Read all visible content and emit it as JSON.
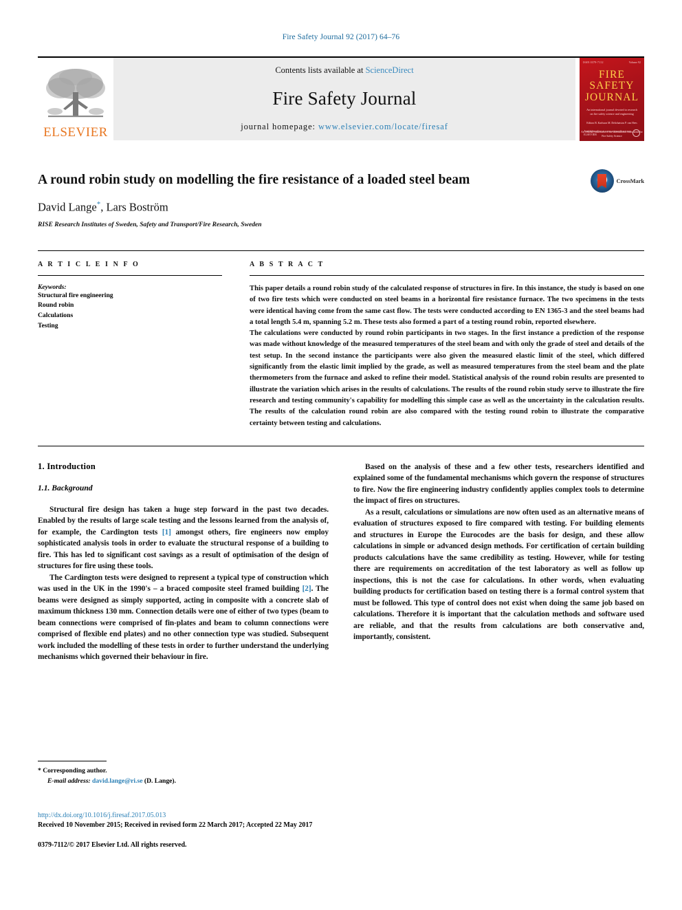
{
  "running_head": "Fire Safety Journal 92 (2017) 64–76",
  "header": {
    "publisher_name": "ELSEVIER",
    "publisher_logo_icon": "elsevier-tree-icon",
    "contents_prefix": "Contents lists available at",
    "contents_link": "ScienceDirect",
    "journal_title": "Fire Safety Journal",
    "homepage_prefix": "journal homepage:",
    "homepage_url": "www.elsevier.com/locate/firesaf",
    "cover": {
      "line1": "FIRE",
      "line2": "SAFETY",
      "line3": "JOURNAL",
      "subtitle": "An international journal devoted to research on fire safety science and engineering",
      "editors": "Editors B. Karlsson M. Delichatsios P. van Hees",
      "assoc": "An Official Publication of the International Association for Fire Safety Science",
      "top_left": "ISSN 0379-7112",
      "top_right": "Volume 92",
      "bottom_left": "Available online at www.sciencedirect.com ELSEVIER",
      "seal_icon": "iafss-seal-icon"
    },
    "colors": {
      "link": "#2a7fb5",
      "band_bg": "#ececec",
      "elsevier_orange": "#e87722",
      "cover_red": "#c5151b"
    }
  },
  "article": {
    "title": "A round robin study on modelling the fire resistance of a loaded steel beam",
    "authors": "David Lange",
    "author_marker": "*",
    "authors_rest": ", Lars Boström",
    "affiliation": "RISE Research Institutes of Sweden, Safety and Transport/Fire Research, Sweden",
    "crossmark_label": "CrossMark"
  },
  "article_info": {
    "heading": "A R T I C L E   I N F O",
    "keywords_label": "Keywords:",
    "keywords": [
      "Structural fire engineering",
      "Round robin",
      "Calculations",
      "Testing"
    ]
  },
  "abstract": {
    "heading": "A B S T R A C T",
    "paragraphs": [
      "This paper details a round robin study of the calculated response of structures in fire. In this instance, the study is based on one of two fire tests which were conducted on steel beams in a horizontal fire resistance furnace. The two specimens in the tests were identical having come from the same cast flow. The tests were conducted according to EN 1365-3 and the steel beams had a total length 5.4 m, spanning 5.2 m. These tests also formed a part of a testing round robin, reported elsewhere.",
      "The calculations were conducted by round robin participants in two stages. In the first instance a prediction of the response was made without knowledge of the measured temperatures of the steel beam and with only the grade of steel and details of the test setup. In the second instance the participants were also given the measured elastic limit of the steel, which differed significantly from the elastic limit implied by the grade, as well as measured temperatures from the steel beam and the plate thermometers from the furnace and asked to refine their model. Statistical analysis of the round robin results are presented to illustrate the variation which arises in the results of calculations. The results of the round robin study serve to illustrate the fire research and testing community's capability for modelling this simple case as well as the uncertainty in the calculation results. The results of the calculation round robin are also compared with the testing round robin to illustrate the comparative certainty between testing and calculations."
    ]
  },
  "body": {
    "section_number_title": "1.  Introduction",
    "subsection_number_title": "1.1.  Background",
    "left_paragraphs": [
      "Structural fire design has taken a huge step forward in the past two decades. Enabled by the results of large scale testing and the lessons learned from the analysis of, for example, the Cardington tests [1] amongst others, fire engineers now employ sophisticated analysis tools in order to evaluate the structural response of a building to fire. This has led to significant cost savings as a result of optimisation of the design of structures for fire using these tools.",
      "The Cardington tests were designed to represent a typical type of construction which was used in the UK in the 1990's – a braced composite steel framed building [2]. The beams were designed as simply supported, acting in composite with a concrete slab of maximum thickness 130 mm. Connection details were one of either of two types (beam to beam connections were comprised of fin-plates and beam to column connections were comprised of flexible end plates) and no other connection type was studied. Subsequent work included the modelling of these tests in order to further understand the underlying mechanisms which governed their behaviour in fire."
    ],
    "right_paragraphs": [
      "Based on the analysis of these and a few other tests, researchers identified and explained some of the fundamental mechanisms which govern the response of structures to fire. Now the fire engineering industry confidently applies complex tools to determine the impact of fires on structures.",
      "As a result, calculations or simulations are now often used as an alternative means of evaluation of structures exposed to fire compared with testing. For building elements and structures in Europe the Eurocodes are the basis for design, and these allow calculations in simple or advanced design methods. For certification of certain building products calculations have the same credibility as testing. However, while for testing there are requirements on accreditation of the test laboratory as well as follow up inspections, this is not the case for calculations. In other words, when evaluating building products for certification based on testing there is a formal control system that must be followed. This type of control does not exist when doing the same job based on calculations. Therefore it is important that the calculation methods and software used are reliable, and that the results from calculations are both conservative and, importantly, consistent."
    ],
    "citation_refs": [
      "[1]",
      "[2]"
    ]
  },
  "footnote": {
    "corresponding_marker": "*",
    "corresponding_text": "Corresponding author.",
    "email_label": "E-mail address:",
    "email": "david.lange@ri.se",
    "email_suffix": "(D. Lange)."
  },
  "footer": {
    "doi": "http://dx.doi.org/10.1016/j.firesaf.2017.05.013",
    "history": "Received 10 November 2015; Received in revised form 22 March 2017; Accepted 22 May 2017",
    "copyright": "0379-7112/© 2017 Elsevier Ltd. All rights reserved."
  }
}
